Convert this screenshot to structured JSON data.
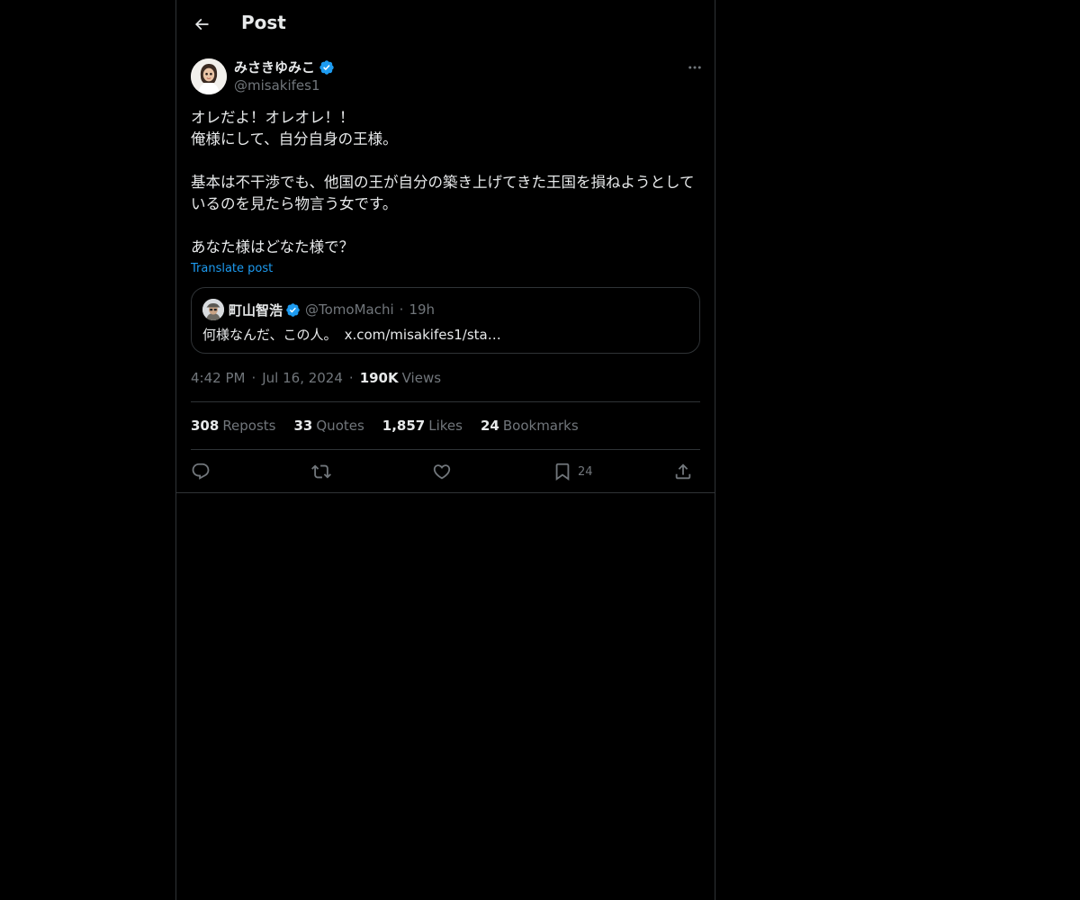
{
  "header": {
    "title": "Post"
  },
  "author": {
    "name": "みさきゆみこ",
    "handle": "@misakifes1",
    "verified": true
  },
  "post": {
    "text": "オレだよ！オレオレ！！\n俺様にして、自分自身の王様。\n\n基本は不干渉でも、他国の王が自分の築き上げてきた王国を損ねようとしているのを見たら物言う女です。\n\nあなた様はどなた様で？",
    "translate_label": "Translate post"
  },
  "quote": {
    "name": "町山智浩",
    "handle": "@TomoMachi",
    "separator": "·",
    "time": "19h",
    "text": "何様なんだ、この人。",
    "link": "x.com/misakifes1/sta…"
  },
  "meta": {
    "time": "4:42 PM",
    "separator": "·",
    "date": "Jul 16, 2024",
    "views_count": "190K",
    "views_label": "Views"
  },
  "stats": [
    {
      "count": "308",
      "label": "Reposts"
    },
    {
      "count": "33",
      "label": "Quotes"
    },
    {
      "count": "1,857",
      "label": "Likes"
    },
    {
      "count": "24",
      "label": "Bookmarks"
    }
  ],
  "actions": {
    "reply": "reply-icon",
    "repost": "repost-icon",
    "like": "heart-icon",
    "bookmark": "bookmark-icon",
    "bookmark_count": "24",
    "share": "share-icon"
  },
  "colors": {
    "background": "#000000",
    "text": "#e7e9ea",
    "muted": "#71767b",
    "accent": "#1d9bf0",
    "border": "#2f3336"
  }
}
